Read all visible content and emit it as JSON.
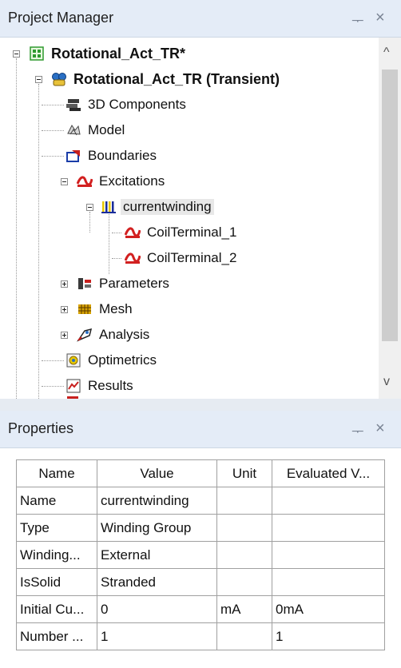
{
  "project_manager": {
    "title": "Project Manager",
    "pin_glyph": "ᅮ",
    "close_glyph": "×",
    "tree": [
      {
        "label": "Rotational_Act_TR*",
        "icon": "project-icon"
      },
      {
        "label": "Rotational_Act_TR (Transient)",
        "icon": "design-icon"
      },
      {
        "label": "3D Components",
        "icon": "components-icon"
      },
      {
        "label": "Model",
        "icon": "model-icon"
      },
      {
        "label": "Boundaries",
        "icon": "boundaries-icon"
      },
      {
        "label": "Excitations",
        "icon": "excitations-icon"
      },
      {
        "label": "currentwinding",
        "icon": "winding-icon"
      },
      {
        "label": "CoilTerminal_1",
        "icon": "coil-terminal-icon"
      },
      {
        "label": "CoilTerminal_2",
        "icon": "coil-terminal-icon"
      },
      {
        "label": "Parameters",
        "icon": "parameters-icon"
      },
      {
        "label": "Mesh",
        "icon": "mesh-icon"
      },
      {
        "label": "Analysis",
        "icon": "analysis-icon"
      },
      {
        "label": "Optimetrics",
        "icon": "optimetrics-icon"
      },
      {
        "label": "Results",
        "icon": "results-icon"
      }
    ],
    "scroll_up_glyph": "^",
    "scroll_down_glyph": "v"
  },
  "properties": {
    "title": "Properties",
    "pin_glyph": "ᅮ",
    "close_glyph": "×",
    "columns": [
      "Name",
      "Value",
      "Unit",
      "Evaluated V..."
    ],
    "rows": [
      [
        "Name",
        "currentwinding",
        "",
        ""
      ],
      [
        "Type",
        "Winding Group",
        "",
        ""
      ],
      [
        "Winding...",
        "External",
        "",
        ""
      ],
      [
        "IsSolid",
        "Stranded",
        "",
        ""
      ],
      [
        "Initial Cu...",
        "0",
        "mA",
        "0mA"
      ],
      [
        "Number ...",
        "1",
        "",
        "1"
      ]
    ]
  },
  "colors": {
    "panel_header": "#e4ecf7",
    "selection": "#e8e8e8",
    "excitation_red": "#d22020",
    "design_blue": "#1f5fae"
  }
}
